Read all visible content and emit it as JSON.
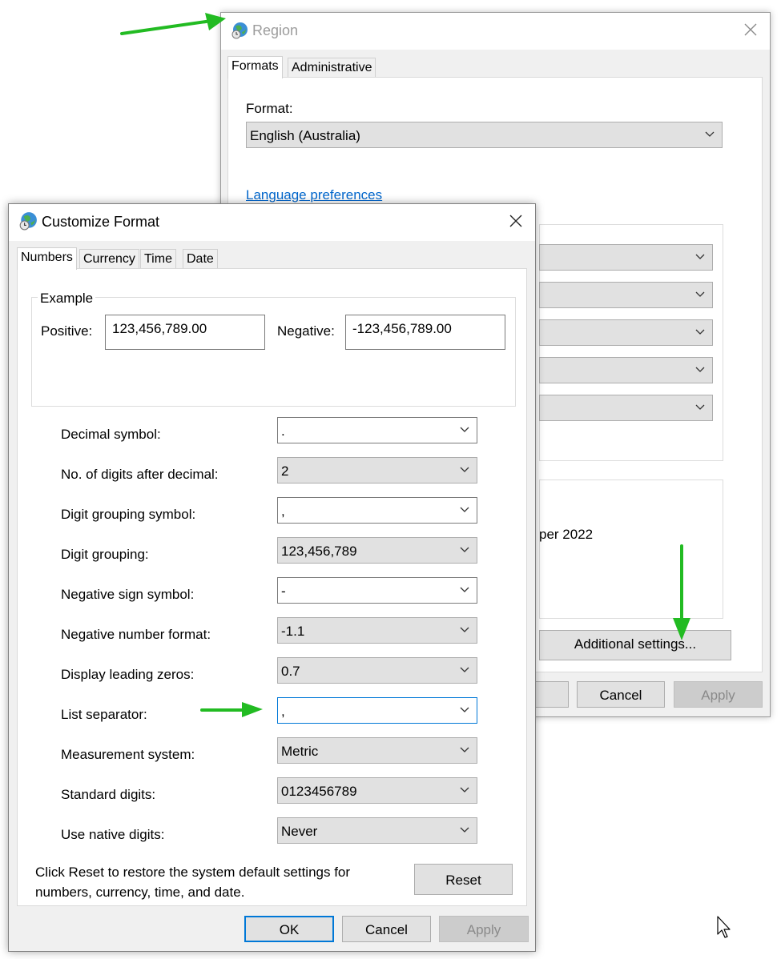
{
  "region": {
    "title": "Region",
    "tabs": [
      "Formats",
      "Administrative"
    ],
    "format_label": "Format:",
    "format_value": "English (Australia)",
    "language_link": "Language preferences",
    "partial_text": "per 2022",
    "additional_settings": "Additional settings...",
    "buttons": {
      "cancel": "Cancel",
      "apply": "Apply"
    }
  },
  "customize": {
    "title": "Customize Format",
    "tabs": [
      "Numbers",
      "Currency",
      "Time",
      "Date"
    ],
    "example": {
      "group_label": "Example",
      "positive_label": "Positive:",
      "positive_value": "123,456,789.00",
      "negative_label": "Negative:",
      "negative_value": "-123,456,789.00"
    },
    "settings": [
      {
        "label": "Decimal symbol:",
        "value": "."
      },
      {
        "label": "No. of digits after decimal:",
        "value": "2"
      },
      {
        "label": "Digit grouping symbol:",
        "value": ","
      },
      {
        "label": "Digit grouping:",
        "value": "123,456,789"
      },
      {
        "label": "Negative sign symbol:",
        "value": "-"
      },
      {
        "label": "Negative number format:",
        "value": "-1.1"
      },
      {
        "label": "Display leading zeros:",
        "value": "0.7"
      },
      {
        "label": "List separator:",
        "value": ","
      },
      {
        "label": "Measurement system:",
        "value": "Metric"
      },
      {
        "label": "Standard digits:",
        "value": "0123456789"
      },
      {
        "label": "Use native digits:",
        "value": "Never"
      }
    ],
    "reset_note": "Click Reset to restore the system default settings for numbers, currency, time, and date.",
    "reset_label": "Reset",
    "buttons": {
      "ok": "OK",
      "cancel": "Cancel",
      "apply": "Apply"
    }
  },
  "colors": {
    "arrow": "#22bb22",
    "focus": "#0078d7",
    "link": "#0066cc"
  },
  "icons": [
    "globe-clock-icon",
    "close-icon",
    "chevron-down-icon",
    "mouse-cursor-icon"
  ]
}
